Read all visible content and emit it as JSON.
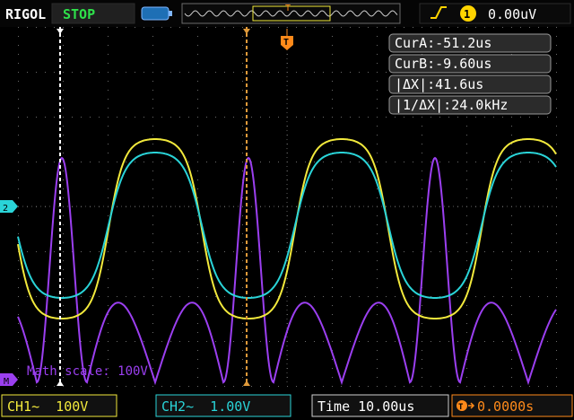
{
  "header": {
    "brand": "RIGOL",
    "run_state": "STOP",
    "trigger": {
      "edge_icon": "rising-edge-icon",
      "channel": "1",
      "level": "0.00uV"
    }
  },
  "cursor_readout": {
    "cur_a": "CurA:-51.2us",
    "cur_b": "CurB:-9.60us",
    "delta_x": "|ΔX|:41.6us",
    "inv_delta_x": "|1/ΔX|:24.0kHz"
  },
  "overlay": {
    "math_scale": "Math scale: 100V"
  },
  "markers": {
    "trigger_pos": "T",
    "channel_marker_icon": "channel-ground-marker-icon",
    "math_marker_icon": "math-ground-marker-icon"
  },
  "footer": {
    "ch1": "CH1~  100V",
    "ch2": "CH2~  1.00V",
    "time": "Time 10.00us",
    "trigger_offset": "0.0000s",
    "trigger_offset_icon": "trigger-offset-icon"
  },
  "colors": {
    "ch1": "#f2e93c",
    "ch2": "#2ad4d8",
    "math": "#9b3ff0",
    "cursor_a": "#ffffff",
    "cursor_b": "#e09a3a",
    "trigger": "#ff8a1a",
    "run_state_bg": "#000000",
    "run_state_fg": "#2ee04a"
  }
}
